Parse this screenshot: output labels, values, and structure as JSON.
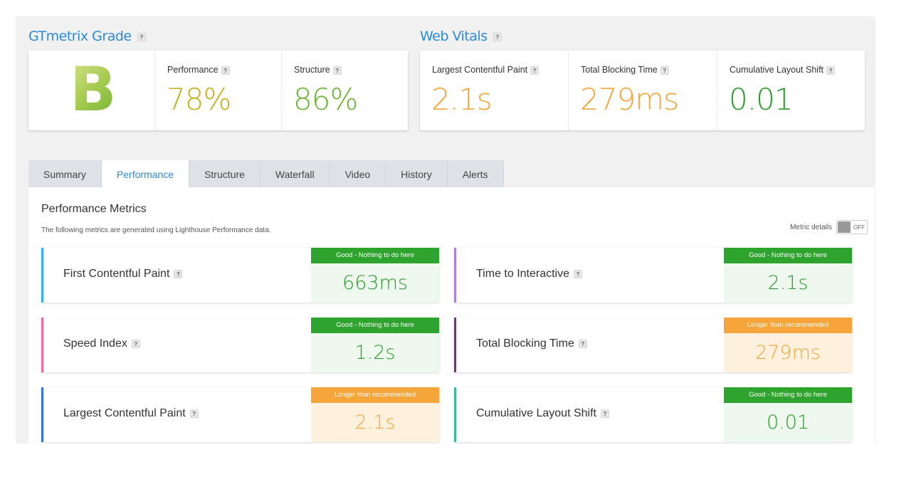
{
  "grade_section": {
    "title": "GTmetrix Grade",
    "help": "?",
    "grade": "B",
    "performance": {
      "label": "Performance",
      "help": "?",
      "value": "78%",
      "color": "#c9ae1e"
    },
    "structure": {
      "label": "Structure",
      "help": "?",
      "value": "86%",
      "color": "#6bb534"
    }
  },
  "vitals_section": {
    "title": "Web Vitals",
    "help": "?",
    "items": [
      {
        "label": "Largest Contentful Paint",
        "help": "?",
        "value": "2.1s",
        "color": "#f6a53a"
      },
      {
        "label": "Total Blocking Time",
        "help": "?",
        "value": "279ms",
        "color": "#f6a53a"
      },
      {
        "label": "Cumulative Layout Shift",
        "help": "?",
        "value": "0.01",
        "color": "#2d9c2d"
      }
    ]
  },
  "tabs": [
    "Summary",
    "Performance",
    "Structure",
    "Waterfall",
    "Video",
    "History",
    "Alerts"
  ],
  "active_tab": "Performance",
  "panel": {
    "title": "Performance Metrics",
    "subtitle": "The following metrics are generated using Lighthouse Performance data.",
    "toggle_label": "Metric details",
    "toggle_state": "OFF"
  },
  "metrics": [
    {
      "label": "First Contentful Paint",
      "help": "?",
      "status": "Good - Nothing to do here",
      "value": "663ms",
      "level": "good",
      "accent": "#2eb6ea"
    },
    {
      "label": "Time to Interactive",
      "help": "?",
      "status": "Good - Nothing to do here",
      "value": "2.1s",
      "level": "good",
      "accent": "#b57ed6"
    },
    {
      "label": "Speed Index",
      "help": "?",
      "status": "Good - Nothing to do here",
      "value": "1.2s",
      "level": "good",
      "accent": "#ea6aa7"
    },
    {
      "label": "Total Blocking Time",
      "help": "?",
      "status": "Longer than recommended",
      "value": "279ms",
      "level": "warn",
      "accent": "#6a3a72"
    },
    {
      "label": "Largest Contentful Paint",
      "help": "?",
      "status": "Longer than recommended",
      "value": "2.1s",
      "level": "warn",
      "accent": "#3a6fd8"
    },
    {
      "label": "Cumulative Layout Shift",
      "help": "?",
      "status": "Good - Nothing to do here",
      "value": "0.01",
      "level": "good",
      "accent": "#3cb89a"
    }
  ],
  "colors": {
    "good_head": "#2ea32e",
    "good_bg": "#eff8ef",
    "good_text": "#2d9c2d",
    "warn_head": "#f6a53a",
    "warn_bg": "#fdf0dc",
    "warn_text": "#f6a53a",
    "link_blue": "#2c8ad6"
  }
}
